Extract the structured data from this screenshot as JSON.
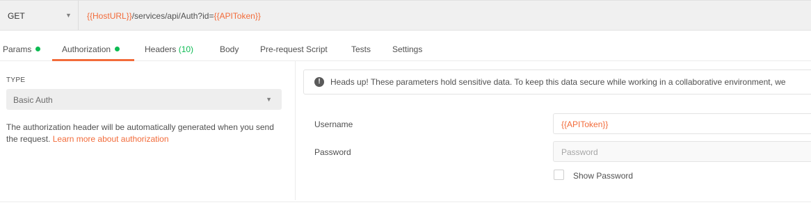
{
  "request": {
    "method": "GET",
    "url_parts": {
      "host_var": "{{HostURL}}",
      "path": "/services/api/Auth?id=",
      "token_var": "{{APIToken}}"
    }
  },
  "tabs": [
    {
      "label": "Params",
      "dot": true
    },
    {
      "label": "Authorization",
      "dot": true,
      "active": true
    },
    {
      "label": "Headers",
      "count": "(10)"
    },
    {
      "label": "Body"
    },
    {
      "label": "Pre-request Script"
    },
    {
      "label": "Tests"
    },
    {
      "label": "Settings"
    }
  ],
  "auth": {
    "type_label": "TYPE",
    "type_value": "Basic Auth",
    "description": "The authorization header will be automatically generated when you send the request.",
    "learn_more": "Learn more about authorization"
  },
  "notice": {
    "text": "Heads up! These parameters hold sensitive data. To keep this data secure while working in a collaborative environment, we"
  },
  "fields": {
    "username_label": "Username",
    "username_value": "{{APIToken}}",
    "password_label": "Password",
    "password_placeholder": "Password",
    "show_password_label": "Show Password"
  },
  "colors": {
    "accent": "#f26b3a",
    "status_green": "#0cbb52"
  },
  "icons": [
    "chevron-down-icon",
    "info-icon"
  ]
}
